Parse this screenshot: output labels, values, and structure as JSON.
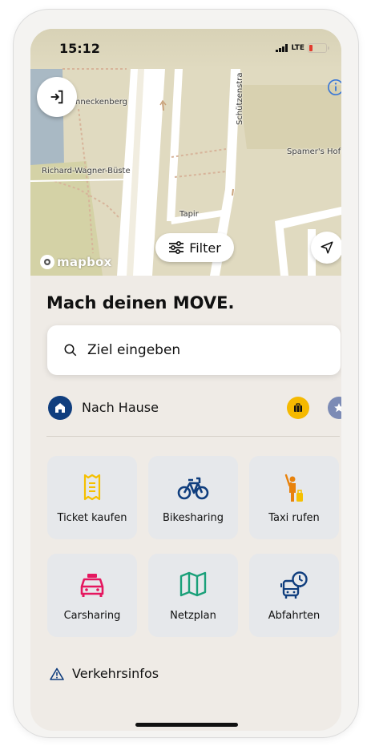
{
  "status_bar": {
    "time": "15:12",
    "network": "LTE"
  },
  "map": {
    "labels": [
      "nneckenberg",
      "Schützenstra",
      "Spamer's Hof",
      "Richard-Wagner-Büste",
      "Tapir"
    ],
    "attribution": "mapbox",
    "filter_label": "Filter"
  },
  "main": {
    "title": "Mach deinen MOVE.",
    "search_placeholder": "Ziel eingeben",
    "home_label": "Nach Hause",
    "tiles": [
      {
        "label": "Ticket kaufen",
        "icon": "ticket-icon",
        "color": "#f5c000"
      },
      {
        "label": "Bikesharing",
        "icon": "bike-icon",
        "color": "#103e7e"
      },
      {
        "label": "Taxi rufen",
        "icon": "taxi-hail-icon",
        "color": "#e8820c"
      },
      {
        "label": "Carsharing",
        "icon": "car-icon",
        "color": "#e5175f"
      },
      {
        "label": "Netzplan",
        "icon": "map-icon",
        "color": "#1aa079"
      },
      {
        "label": "Abfahrten",
        "icon": "departures-icon",
        "color": "#103e7e"
      }
    ],
    "traffic_label": "Verkehrsinfos"
  },
  "colors": {
    "primary": "#103e7e",
    "work": "#f5b900",
    "favorite": "#7c8bb5",
    "background": "#efebe6"
  }
}
